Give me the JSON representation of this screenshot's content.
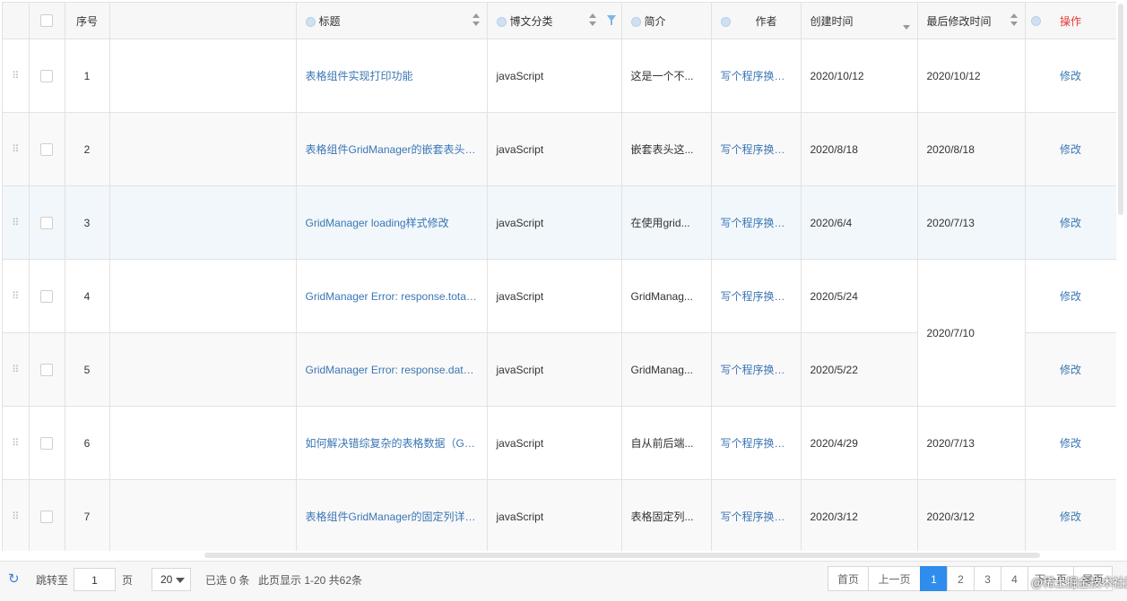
{
  "headers": {
    "index": "序号",
    "title": "标题",
    "category": "博文分类",
    "intro": "简介",
    "author": "作者",
    "created": "创建时间",
    "modified": "最后修改时间",
    "action": "操作"
  },
  "rows": [
    {
      "index": "1",
      "title": "表格组件实现打印功能",
      "category": "javaScript",
      "intro": "这是一个不...",
      "author": "写个程序换个饼...",
      "created": "2020/10/12",
      "modified": "2020/10/12",
      "action": "修改"
    },
    {
      "index": "2",
      "title": "表格组件GridManager的嵌套表头详解",
      "category": "javaScript",
      "intro": "嵌套表头这...",
      "author": "写个程序换个饼...",
      "created": "2020/8/18",
      "modified": "2020/8/18",
      "action": "修改"
    },
    {
      "index": "3",
      "title": "GridManager loading样式修改",
      "category": "javaScript",
      "intro": "在使用grid...",
      "author": "写个程序换个饼...",
      "created": "2020/6/4",
      "modified": "2020/7/13",
      "action": "修改"
    },
    {
      "index": "4",
      "title": "GridManager Error: response.totals undefined",
      "category": "javaScript",
      "intro": "GridManag...",
      "author": "写个程序换个饼...",
      "created": "2020/5/24",
      "modified": "2020/7/10",
      "action": "修改"
    },
    {
      "index": "5",
      "title": "GridManager Error: response.data is not array",
      "category": "javaScript",
      "intro": "GridManag...",
      "author": "写个程序换个饼...",
      "created": "2020/5/22",
      "modified": "",
      "action": "修改"
    },
    {
      "index": "6",
      "title": "如何解决错综复杂的表格数据（GridManager）",
      "category": "javaScript",
      "intro": "自从前后端...",
      "author": "写个程序换个饼...",
      "created": "2020/4/29",
      "modified": "2020/7/13",
      "action": "修改"
    },
    {
      "index": "7",
      "title": "表格组件GridManager的固定列详解...",
      "category": "javaScript",
      "intro": "表格固定列...",
      "author": "写个程序换个饼...",
      "created": "2020/3/12",
      "modified": "2020/3/12",
      "action": "修改"
    }
  ],
  "footer": {
    "jump_label": "跳转至",
    "jump_value": "1",
    "page_unit": "页",
    "page_size": "20",
    "selected": "已选 0 条",
    "info": "此页显示 1-20 共62条"
  },
  "pager": {
    "first": "首页",
    "prev": "上一页",
    "pages": [
      "1",
      "2",
      "3",
      "4"
    ],
    "next": "下一页",
    "last": "尾页"
  },
  "watermark": "@稀土掘金技术社区",
  "colors": {
    "accent": "#2e8ded",
    "link": "#3b76b4",
    "action_header": "#e53935"
  }
}
